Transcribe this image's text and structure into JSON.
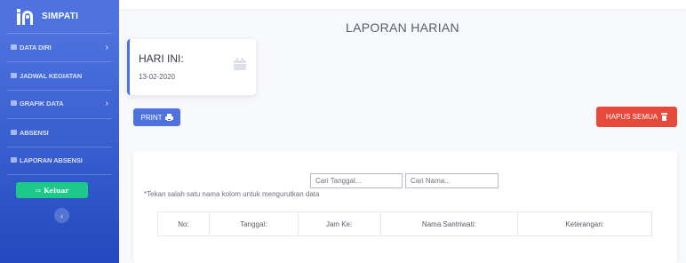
{
  "sidebar": {
    "brand": "SIMPATI",
    "items": [
      {
        "label": "DATA DIRI",
        "icon": "user-icon",
        "chevron": "›"
      },
      {
        "label": "JADWAL KEGIATAN",
        "icon": "calendar-icon"
      },
      {
        "label": "GRAFIK DATA",
        "icon": "chart-icon",
        "chevron": "›"
      },
      {
        "label": "ABSENSI",
        "icon": "list-icon"
      },
      {
        "label": "LAPORAN ABSENSI",
        "icon": "report-icon"
      }
    ],
    "logout_label": "Keluar",
    "toggle_glyph": "‹"
  },
  "main": {
    "title": "LAPORAN HARIAN",
    "today": {
      "label": "HARI INI:",
      "date": "13-02-2020"
    },
    "print_label": "PRINT",
    "delete_all_label": "HAPUS SEMUA",
    "search": {
      "date_placeholder": "Cari Tanggal...",
      "name_placeholder": "Cari Nama..."
    },
    "hint": "*Tekan salah satu nama kolom untuk mengurutkan data",
    "table": {
      "columns": [
        "No:",
        "Tanggal:",
        "Jam Ke:",
        "Nama Santriwati:",
        "Keterangan:"
      ]
    }
  },
  "colors": {
    "sidebar": "#4e73df",
    "primary": "#4e73df",
    "success": "#1cc88a",
    "danger": "#e74a3b"
  }
}
